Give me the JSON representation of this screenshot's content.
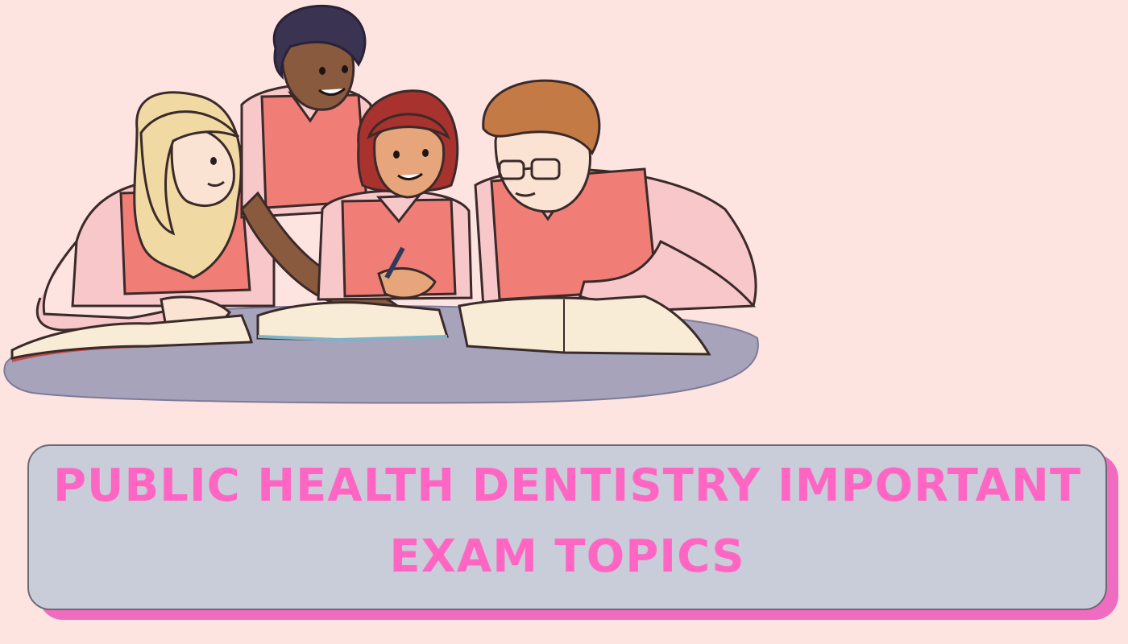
{
  "banner": {
    "title_line1": "PUBLIC HEALTH DENTISTRY IMPORTANT",
    "title_line2": "EXAM TOPICS"
  },
  "illustration": {
    "subject": "students-studying-icon"
  },
  "colors": {
    "background": "#fde4e1",
    "title_text": "#ff66c4",
    "card_fill": "#c9cdd9",
    "card_shadow": "#f06cc0",
    "table": "#a6a3bb",
    "vest": "#f07e76",
    "shirt": "#f8c7c9"
  }
}
